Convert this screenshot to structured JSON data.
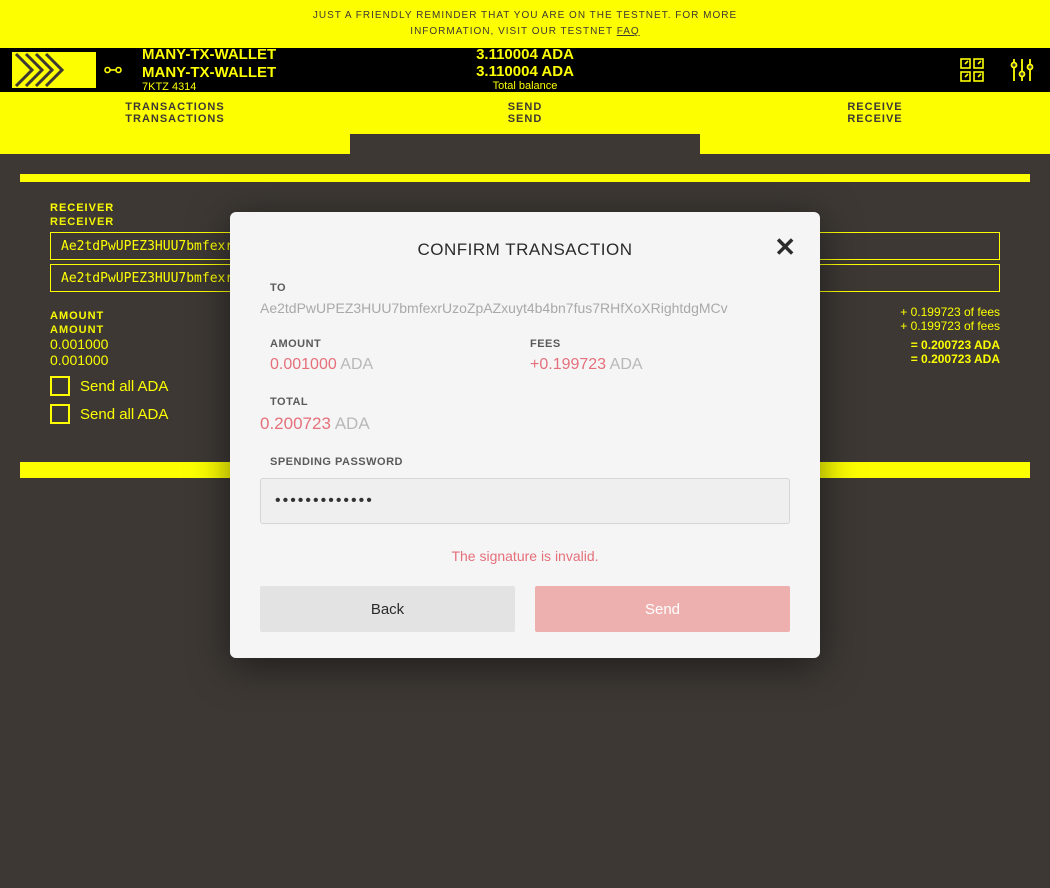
{
  "banner": {
    "line1": "JUST A FRIENDLY REMINDER THAT YOU ARE ON THE TESTNET. FOR MORE",
    "line2_prefix": "INFORMATION, VISIT OUR TESTNET ",
    "line2_link": "FAQ"
  },
  "header": {
    "wallet_name_1": "MANY-TX-WALLET",
    "wallet_name_2": "MANY-TX-WALLET",
    "wallets_count": "7KTZ  4314",
    "balance_1": "3.110004 ADA",
    "balance_2": "3.110004 ADA",
    "balance_label": "Total balance"
  },
  "tabs": {
    "transactions": "TRANSACTIONS",
    "send": "SEND",
    "receive": "RECEIVE"
  },
  "form": {
    "receiver_label": "RECEIVER",
    "receiver_value": "Ae2tdPwUPEZ3HUU7bmfexrUzoZpAZxuyt4b4bn7fus7RHfXoXRightdgMCv",
    "amount_label": "AMOUNT",
    "amount_value": "0.001000",
    "fees_text": "+ 0.199723 of fees",
    "total_text": "= 0.200723 ADA",
    "send_all": "Send all ADA"
  },
  "modal": {
    "title": "CONFIRM TRANSACTION",
    "to_label": "TO",
    "to_value": "Ae2tdPwUPEZ3HUU7bmfexrUzoZpAZxuyt4b4bn7fus7RHfXoXRightdgMCv",
    "amount_label": "AMOUNT",
    "amount_value": "0.001000",
    "fees_label": "FEES",
    "fees_value": "+0.199723",
    "total_label": "TOTAL",
    "total_value": "0.200723",
    "currency": "ADA",
    "password_label": "SPENDING PASSWORD",
    "password_value": "•••••••••••••",
    "error": "The signature is invalid.",
    "back": "Back",
    "send": "Send"
  },
  "chart_data": null
}
